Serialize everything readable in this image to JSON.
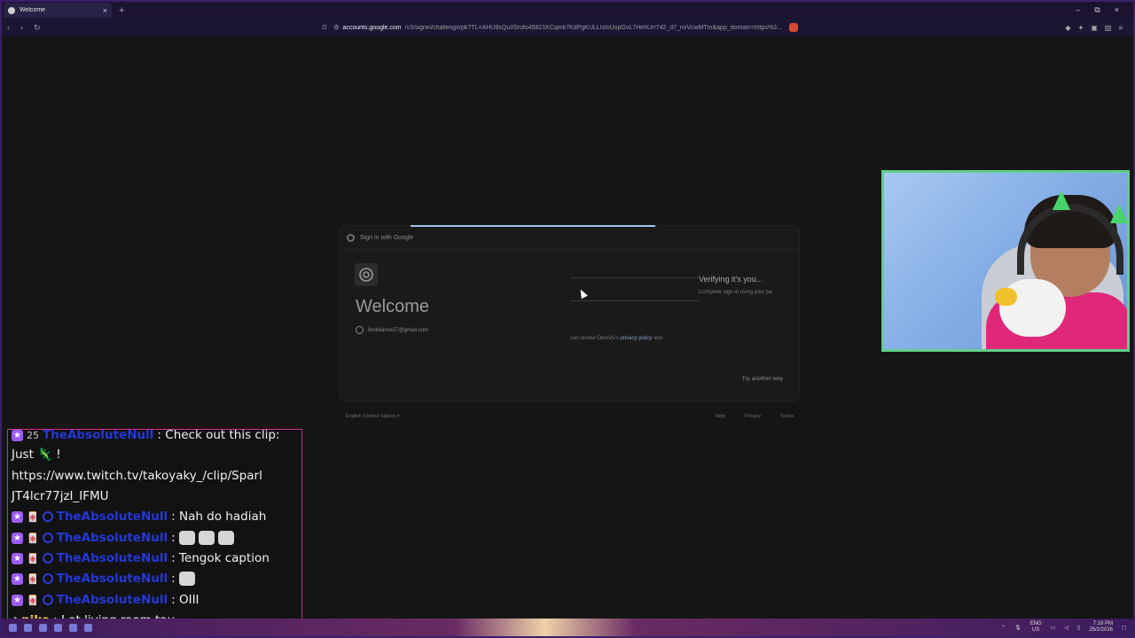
{
  "browser": {
    "tab_title": "Welcome",
    "tab_close": "×",
    "new_tab": "+",
    "url_domain": "accounts.google.com",
    "url_path": "/v3/signin/challenge/pk?TL=AHU8sQuX5rufo45821KCqmk7KdPgKULLIslnUupGvL7HehUrr742_d7_nvVcwMTm&app_domain=https%3A%...",
    "window_controls": [
      "–",
      "⧉",
      "×"
    ],
    "nav_icons": [
      "‹",
      "›",
      "↻"
    ]
  },
  "signin": {
    "header": "Sign in with Google",
    "welcome": "Welcome",
    "account_email": "ferdelance27@gmail.com",
    "verify_title": "Verifying it's you...",
    "verify_sub": "Complete sign-in using your pa",
    "policy_prefix": "can review OpenAI's ",
    "policy_link": "privacy policy",
    "policy_suffix": " and",
    "try_another": "Try another way",
    "language": "English (United States)",
    "footer_links": [
      "Help",
      "Privacy",
      "Terms"
    ]
  },
  "chat": {
    "lines": [
      {
        "user": "TheAbsoluteNull",
        "text": ": Check out this clip:"
      },
      {
        "user": "",
        "text": "Just 🦎 !"
      },
      {
        "user": "",
        "text": "https://www.twitch.tv/takoyaky_/clip/Sparl"
      },
      {
        "user": "",
        "text": "JT4lcr77jzI_IFMU"
      },
      {
        "user": "TheAbsoluteNull",
        "text": ": Nah do hadiah"
      },
      {
        "user": "TheAbsoluteNull",
        "text": ":"
      },
      {
        "user": "TheAbsoluteNull",
        "text": ": Tengok caption"
      },
      {
        "user": "TheAbsoluteNull",
        "text": ":"
      },
      {
        "user": "TheAbsoluteNull",
        "text": ": OIII"
      },
      {
        "user": "niko",
        "text": ": I at living room tau"
      }
    ],
    "badge_count": "25"
  },
  "taskbar": {
    "lang_top": "ENG",
    "lang_bottom": "US",
    "time": "7:18 PM",
    "date": "25/2/2026"
  },
  "colors": {
    "accent": "#3a1f6a",
    "chat_border": "#d12c8a",
    "webcam_border": "#5fd08a",
    "username": "#2437d8"
  }
}
